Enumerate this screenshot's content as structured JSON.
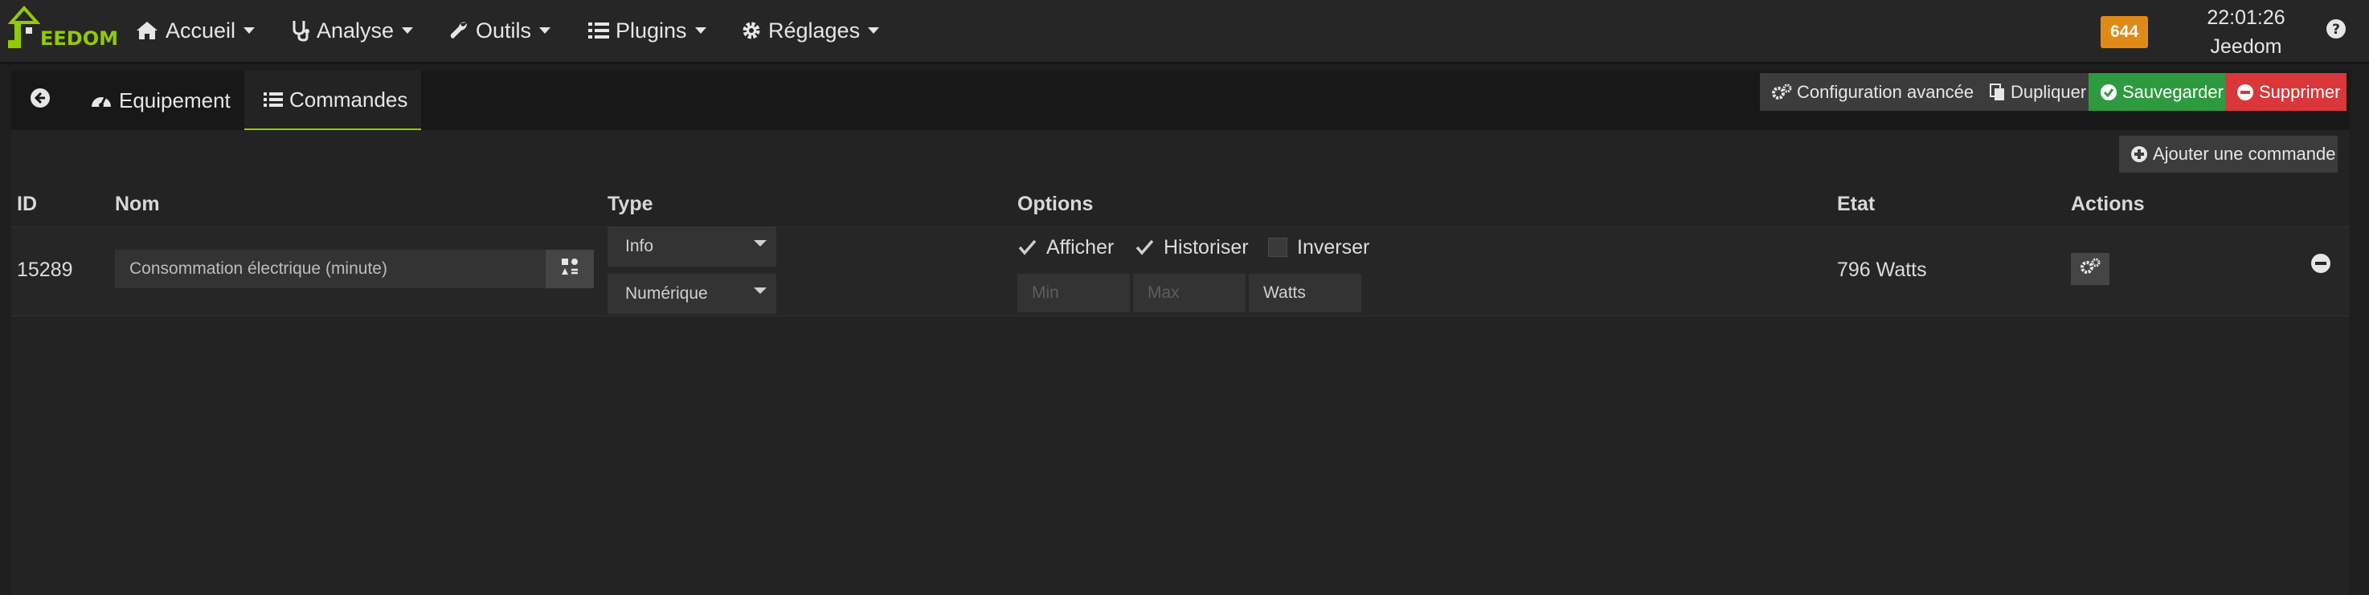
{
  "brand": {
    "text": "EEDOM",
    "color": "#94ca02"
  },
  "nav": {
    "items": [
      {
        "label": "Accueil",
        "icon": "home-icon"
      },
      {
        "label": "Analyse",
        "icon": "stethoscope-icon"
      },
      {
        "label": "Outils",
        "icon": "wrench-icon"
      },
      {
        "label": "Plugins",
        "icon": "list-icon"
      },
      {
        "label": "Réglages",
        "icon": "gear-icon"
      }
    ],
    "message_count": "644",
    "time": "22:01:26",
    "user": "Jeedom",
    "help_icon": "question-circle-icon"
  },
  "tabs": {
    "back_icon": "arrow-circle-left-icon",
    "equipement": "Equipement",
    "commandes": "Commandes"
  },
  "actions": {
    "config": "Configuration avancée",
    "duplicate": "Dupliquer",
    "save": "Sauvegarder",
    "delete": "Supprimer",
    "add_command": "Ajouter une commande"
  },
  "table": {
    "headers": {
      "id": "ID",
      "name": "Nom",
      "type": "Type",
      "options": "Options",
      "state": "Etat",
      "actions": "Actions"
    },
    "row": {
      "id": "15289",
      "name": "Consommation électrique (minute)",
      "type": "Info",
      "subtype": "Numérique",
      "afficher": "Afficher",
      "historiser": "Historiser",
      "inverser": "Inverser",
      "min_placeholder": "Min",
      "max_placeholder": "Max",
      "unit": "Watts",
      "state": "796 Watts"
    }
  },
  "colors": {
    "accent": "#94ca02",
    "success": "#2e9a3f",
    "danger": "#d9373a",
    "badge": "#e08a16"
  }
}
